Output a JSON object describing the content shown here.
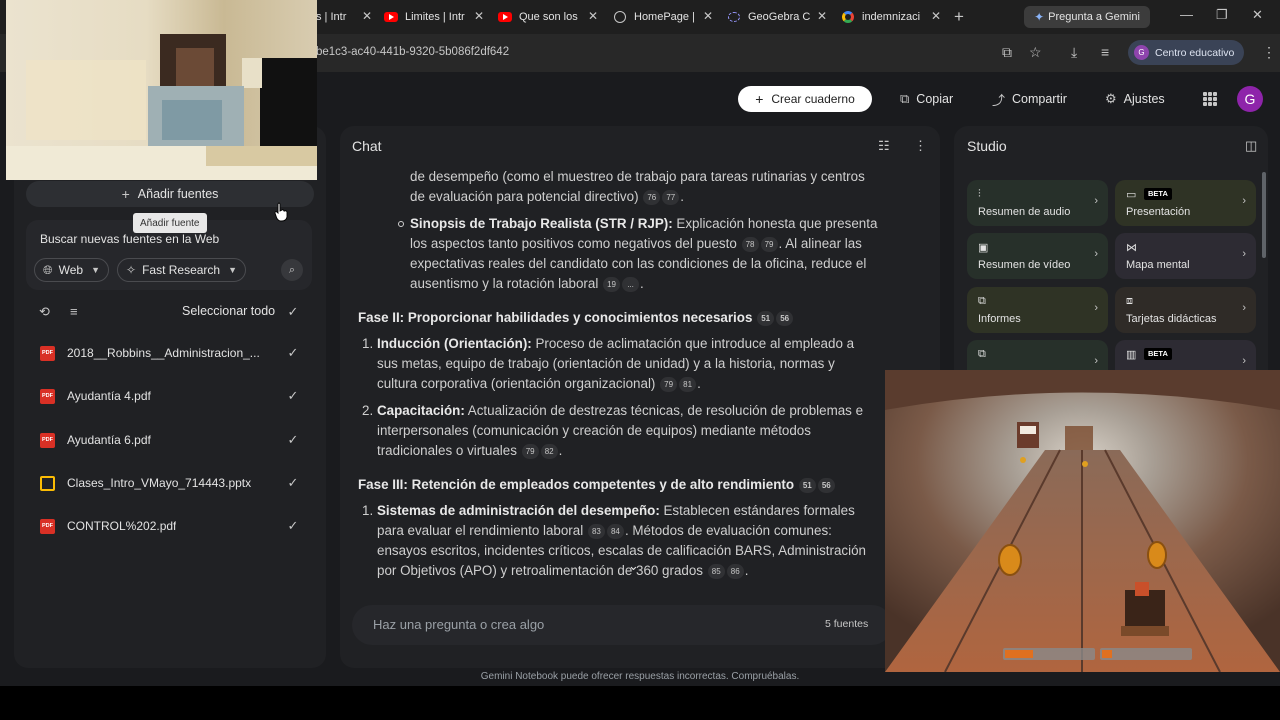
{
  "browser": {
    "tabs": [
      {
        "label": "s | Intr",
        "icon": "youtube-icon"
      },
      {
        "label": "Limites | Intr",
        "icon": "youtube-icon"
      },
      {
        "label": "Que son los",
        "icon": "youtube-icon"
      },
      {
        "label": "HomePage |",
        "icon": "globe-icon"
      },
      {
        "label": "GeoGebra C",
        "icon": "geogebra-icon"
      },
      {
        "label": "indemnizaci",
        "icon": "google-icon"
      }
    ],
    "gemini_tab": "Pregunta a Gemini",
    "url": "be1c3-ac40-441b-9320-5b086f2df642",
    "profile": "Centro educativo",
    "profile_initial": "G"
  },
  "topbar": {
    "create_notebook": "Crear cuaderno",
    "copy": "Copiar",
    "share": "Compartir",
    "settings": "Ajustes",
    "avatar_initial": "G"
  },
  "sources": {
    "add_sources": "Añadir fuentes",
    "tooltip": "Añadir fuente",
    "search_web_label": "Buscar nuevas fuentes en la Web",
    "web_chip": "Web",
    "research_chip": "Fast Research",
    "select_all": "Seleccionar todo",
    "files": [
      {
        "name": "2018__Robbins__Administracion_...",
        "type": "PDF"
      },
      {
        "name": "Ayudantía 4.pdf",
        "type": "PDF"
      },
      {
        "name": "Ayudantía 6.pdf",
        "type": "PDF"
      },
      {
        "name": "Clases_Intro_VMayo_714443.pptx",
        "type": "slides"
      },
      {
        "name": "CONTROL%202.pdf",
        "type": "PDF"
      }
    ]
  },
  "chat": {
    "title": "Chat",
    "line1": "de desempeño (como el muestreo de trabajo para tareas rutinarias y centros",
    "line2a": "de evaluación para potencial directivo)",
    "c1": [
      "76",
      "77"
    ],
    "sinopsis_bold": "Sinopsis de Trabajo Realista (STR / RJP):",
    "sinopsis_1": " Explicación honesta que presenta",
    "sinopsis_2": "los aspectos tanto positivos como negativos del puesto",
    "c2": [
      "78",
      "79"
    ],
    "sinopsis_2b": ". Al alinear las",
    "sinopsis_3": "expectativas reales del candidato con las condiciones de la oficina, reduce el",
    "sinopsis_4": "ausentismo y la rotación laboral",
    "c3": [
      "19",
      "..."
    ],
    "phase2": "Fase II: Proporcionar habilidades y conocimientos necesarios",
    "c4": [
      "51",
      "56"
    ],
    "induc_bold": "Inducción (Orientación):",
    "induc_1": " Proceso de aclimatación que introduce al empleado a",
    "induc_2": "sus metas, equipo de trabajo (orientación de unidad) y a la historia, normas y",
    "induc_3": "cultura corporativa (orientación organizacional)",
    "c5": [
      "79",
      "81"
    ],
    "cap_bold": "Capacitación:",
    "cap_1": " Actualización de destrezas técnicas, de resolución de problemas e",
    "cap_2": "interpersonales (comunicación y creación de equipos) mediante métodos",
    "cap_3": "tradicionales o virtuales",
    "c6": [
      "79",
      "82"
    ],
    "phase3": "Fase III: Retención de empleados competentes y de alto rendimiento",
    "c7": [
      "51",
      "56"
    ],
    "sis_bold": "Sistemas de administración del desempeño:",
    "sis_1": " Establecen estándares formales",
    "sis_2": "para evaluar el rendimiento laboral",
    "c8": [
      "83",
      "84"
    ],
    "sis_2b": ". Métodos de evaluación comunes:",
    "sis_3": "ensayos escritos, incidentes críticos, escalas de calificación BARS, Administración",
    "sis_4": "por Objetivos (APO) y retroalimentación de 360 grados",
    "c9": [
      "85",
      "86"
    ],
    "n1": "1.",
    "n2": "2.",
    "dot": ".",
    "input_placeholder": "Haz una pregunta o crea algo",
    "sources_count": "5 fuentes"
  },
  "studio": {
    "title": "Studio",
    "cards": [
      {
        "label": "Resumen de audio",
        "icon": "audio-icon",
        "color": "#27302a"
      },
      {
        "label": "Presentación",
        "icon": "slides-icon",
        "color": "#2f3325",
        "beta": "BETA"
      },
      {
        "label": "Resumen de vídeo",
        "icon": "video-icon",
        "color": "#27302a"
      },
      {
        "label": "Mapa mental",
        "icon": "mindmap-icon",
        "color": "#2d2b33"
      },
      {
        "label": "Informes",
        "icon": "report-icon",
        "color": "#2f3325"
      },
      {
        "label": "Tarjetas didácticas",
        "icon": "cards-icon",
        "color": "#2f2b27"
      },
      {
        "label": "",
        "icon": "quiz-icon",
        "color": "#27302a"
      },
      {
        "label": "",
        "icon": "infographic-icon",
        "color": "#2d2b33",
        "beta": "BETA"
      }
    ]
  },
  "footer": "Gemini Notebook puede ofrecer respuestas incorrectas. Compruébalas."
}
